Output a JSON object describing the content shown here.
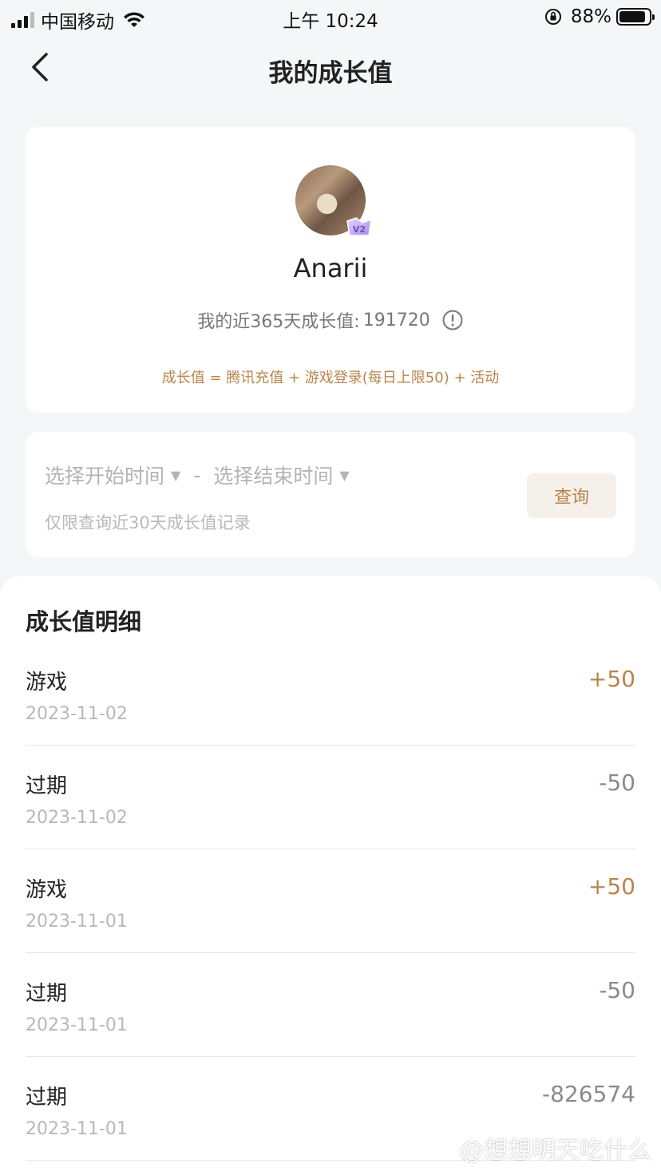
{
  "status_bar": {
    "carrier": "中国移动",
    "time": "上午 10:24",
    "battery_percent": "88%",
    "battery_level": 0.88
  },
  "nav": {
    "title": "我的成长值"
  },
  "profile": {
    "username": "Anarii",
    "total_label": "我的近365天成长值:",
    "total_value": "191720",
    "formula": "成长值 = 腾讯充值 + 游戏登录(每日上限50) + 活动",
    "badge_text": "V2"
  },
  "filter": {
    "start_placeholder": "选择开始时间",
    "end_placeholder": "选择结束时间",
    "separator": "-",
    "note": "仅限查询近30天成长值记录",
    "query_label": "查询"
  },
  "details": {
    "title": "成长值明细",
    "rows": [
      {
        "name": "游戏",
        "date": "2023-11-02",
        "value": "+50",
        "type": "positive"
      },
      {
        "name": "过期",
        "date": "2023-11-02",
        "value": "-50",
        "type": "negative"
      },
      {
        "name": "游戏",
        "date": "2023-11-01",
        "value": "+50",
        "type": "positive"
      },
      {
        "name": "过期",
        "date": "2023-11-01",
        "value": "-50",
        "type": "negative"
      },
      {
        "name": "过期",
        "date": "2023-11-01",
        "value": "-826574",
        "type": "negative"
      }
    ]
  },
  "watermark": "@想想明天吃什么",
  "colors": {
    "accent": "#b8864c",
    "negative": "#8a8a8e",
    "background": "#f5f6f8"
  }
}
